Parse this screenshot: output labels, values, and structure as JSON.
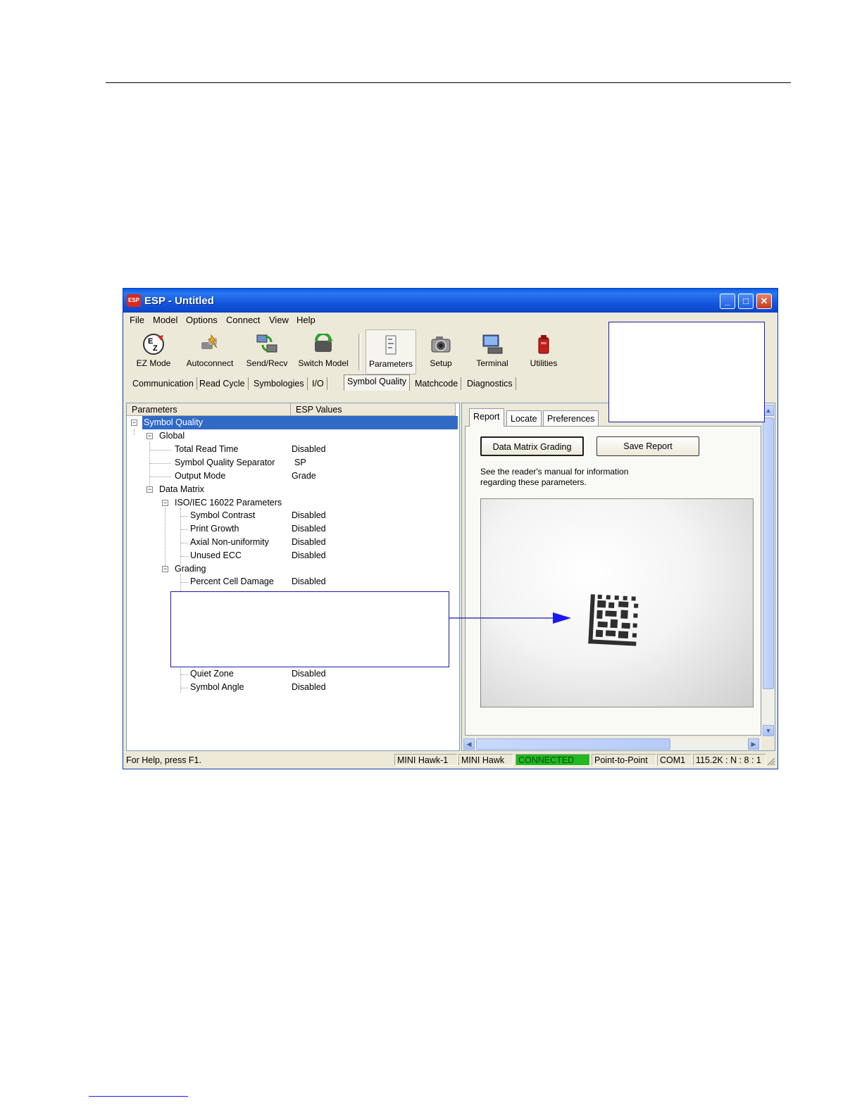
{
  "window": {
    "icon_label": "ESP",
    "title": "ESP - Untitled",
    "controls": {
      "minimize": "_",
      "maximize": "□",
      "close": "✕"
    }
  },
  "menu": [
    "File",
    "Model",
    "Options",
    "Connect",
    "View",
    "Help"
  ],
  "toolbar": [
    {
      "label": "EZ Mode",
      "icon": "ez-mode-icon"
    },
    {
      "label": "Autoconnect",
      "icon": "autoconnect-icon"
    },
    {
      "label": "Send/Recv",
      "icon": "send-recv-icon"
    },
    {
      "label": "Switch Model",
      "icon": "switch-model-icon"
    },
    {
      "label": "Parameters",
      "icon": "parameters-icon"
    },
    {
      "label": "Setup",
      "icon": "camera-icon"
    },
    {
      "label": "Terminal",
      "icon": "terminal-icon"
    },
    {
      "label": "Utilities",
      "icon": "utilities-icon"
    }
  ],
  "tabs": [
    "Communication",
    "Read Cycle",
    "Symbologies",
    "I/O",
    "Symbol Quality",
    "Matchcode",
    "Diagnostics"
  ],
  "left_panel": {
    "headers": {
      "parameters": "Parameters",
      "values": "ESP Values"
    },
    "tree": [
      {
        "label": "Symbol Quality",
        "value": ""
      },
      {
        "label": "Global",
        "value": ""
      },
      {
        "label": "Total Read Time",
        "value": "Disabled"
      },
      {
        "label": "Symbol Quality Separator",
        "value": "SP"
      },
      {
        "label": "Output Mode",
        "value": "Grade"
      },
      {
        "label": "Data Matrix",
        "value": ""
      },
      {
        "label": "ISO/IEC 16022 Parameters",
        "value": ""
      },
      {
        "label": "Symbol Contrast",
        "value": "Disabled"
      },
      {
        "label": "Print Growth",
        "value": "Disabled"
      },
      {
        "label": "Axial Non-uniformity",
        "value": "Disabled"
      },
      {
        "label": "Unused ECC",
        "value": "Disabled"
      },
      {
        "label": "Grading",
        "value": ""
      },
      {
        "label": "Percent Cell Damage",
        "value": "Disabled"
      },
      {
        "label": "Quiet Zone",
        "value": "Disabled"
      },
      {
        "label": "Symbol Angle",
        "value": "Disabled"
      }
    ]
  },
  "right_panel": {
    "tabs": [
      "Report",
      "Locate",
      "Preferences"
    ],
    "buttons": {
      "grading": "Data Matrix Grading",
      "save": "Save Report"
    },
    "info": [
      "See the reader's manual for information",
      "regarding these parameters."
    ]
  },
  "status": {
    "help": "For Help, press F1.",
    "device": "MINI Hawk-1",
    "model": "MINI Hawk",
    "connection": "CONNECTED",
    "mode": "Point-to-Point",
    "port": "COM1",
    "settings": "115.2K : N : 8 : 1"
  }
}
